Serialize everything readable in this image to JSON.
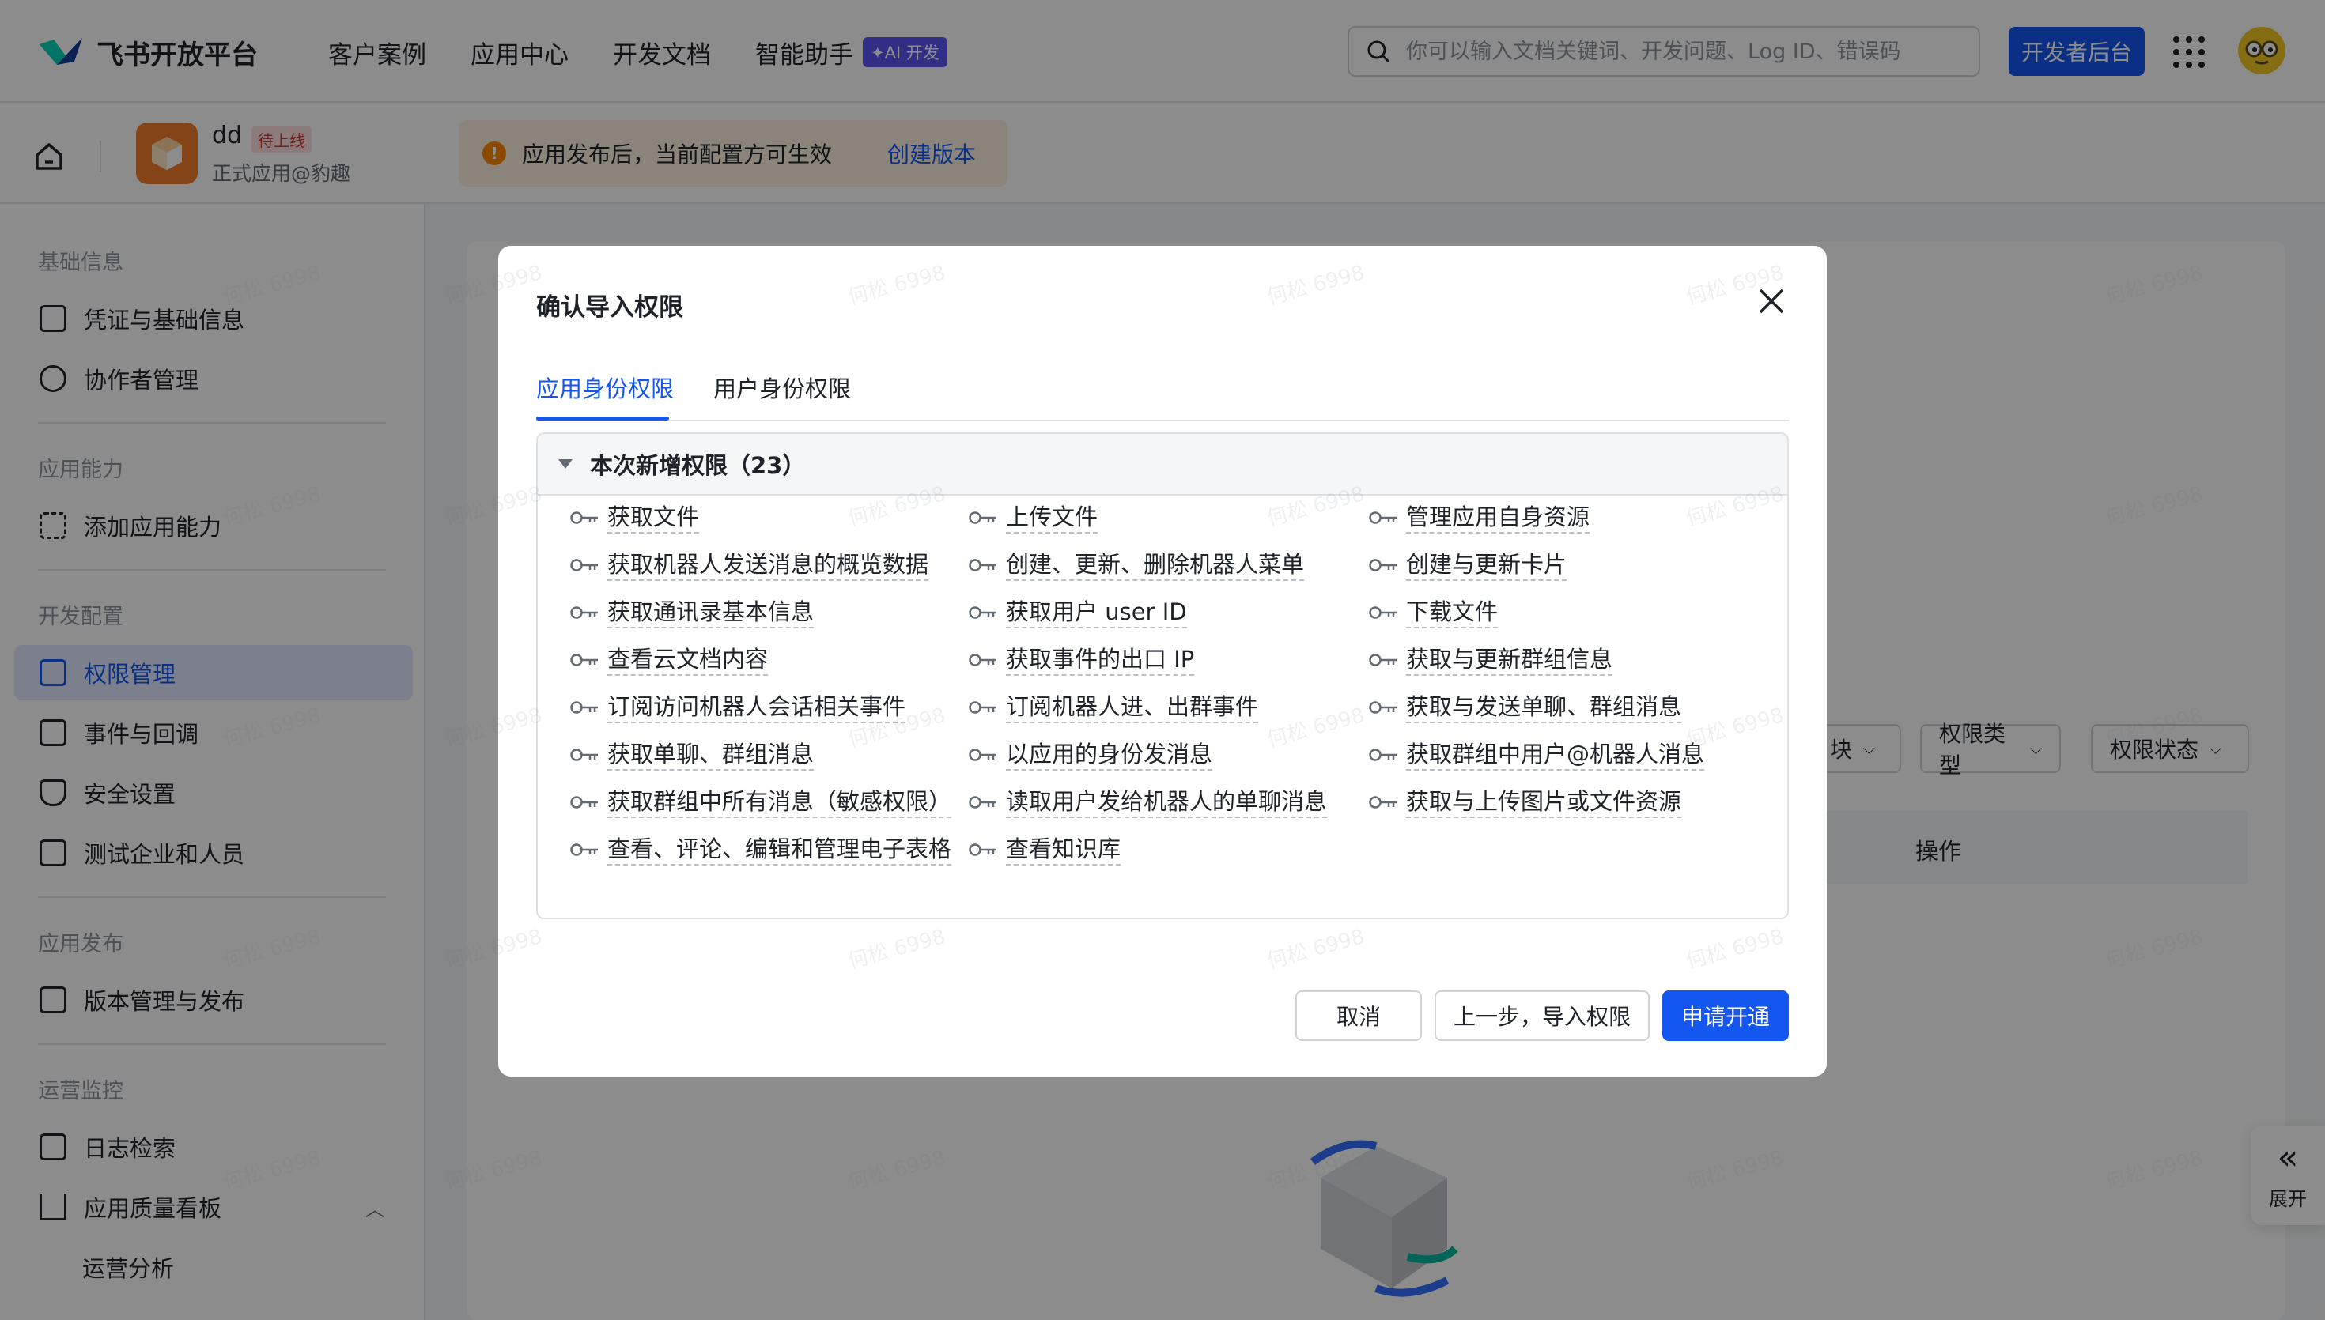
{
  "brand": {
    "name": "飞书开放平台"
  },
  "nav": {
    "links": [
      "客户案例",
      "应用中心",
      "开发文档",
      "智能助手"
    ],
    "ai_badge": "✦AI 开发",
    "search_placeholder": "你可以输入文档关键词、开发问题、Log ID、错误码",
    "dev_button": "开发者后台"
  },
  "app": {
    "name": "dd",
    "status": "待上线",
    "subtitle": "正式应用@豹趣"
  },
  "notice": {
    "text": "应用发布后，当前配置方可生效",
    "link": "创建版本"
  },
  "sidebar": {
    "groups": [
      "基础信息",
      "应用能力",
      "开发配置",
      "应用发布",
      "运营监控"
    ],
    "items": [
      {
        "label": "凭证与基础信息",
        "icon": "credential-icon"
      },
      {
        "label": "协作者管理",
        "icon": "user-icon"
      },
      {
        "label": "添加应用能力",
        "icon": "apps-grid-icon"
      },
      {
        "label": "权限管理",
        "icon": "briefcase-icon",
        "active": true
      },
      {
        "label": "事件与回调",
        "icon": "event-icon"
      },
      {
        "label": "安全设置",
        "icon": "shield-icon"
      },
      {
        "label": "测试企业和人员",
        "icon": "code-icon"
      },
      {
        "label": "版本管理与发布",
        "icon": "upload-icon"
      },
      {
        "label": "日志检索",
        "icon": "log-search-icon"
      },
      {
        "label": "应用质量看板",
        "icon": "bar-chart-icon"
      },
      {
        "label": "运营分析",
        "icon": ""
      }
    ]
  },
  "background": {
    "filters": [
      "块",
      "权限类型",
      "权限状态"
    ],
    "table_header": "操作",
    "expand_label": "展开"
  },
  "modal": {
    "title": "确认导入权限",
    "tabs": [
      "应用身份权限",
      "用户身份权限"
    ],
    "panel_title": "本次新增权限（23）",
    "permissions": [
      "获取文件",
      "上传文件",
      "管理应用自身资源",
      "获取机器人发送消息的概览数据",
      "创建、更新、删除机器人菜单",
      "创建与更新卡片",
      "获取通讯录基本信息",
      "获取用户 user ID",
      "下载文件",
      "查看云文档内容",
      "获取事件的出口 IP",
      "获取与更新群组信息",
      "订阅访问机器人会话相关事件",
      "订阅机器人进、出群事件",
      "获取与发送单聊、群组消息",
      "获取单聊、群组消息",
      "以应用的身份发消息",
      "获取群组中用户@机器人消息",
      "获取群组中所有消息（敏感权限）",
      "读取用户发给机器人的单聊消息",
      "获取与上传图片或文件资源",
      "查看、评论、编辑和管理电子表格",
      "查看知识库"
    ],
    "buttons": {
      "cancel": "取消",
      "back": "上一步，导入权限",
      "submit": "申请开通"
    }
  },
  "watermark": "何松 6998",
  "colors": {
    "accent": "#1456f0",
    "warning": "#ff8800",
    "app_icon": "#f37c2a"
  }
}
